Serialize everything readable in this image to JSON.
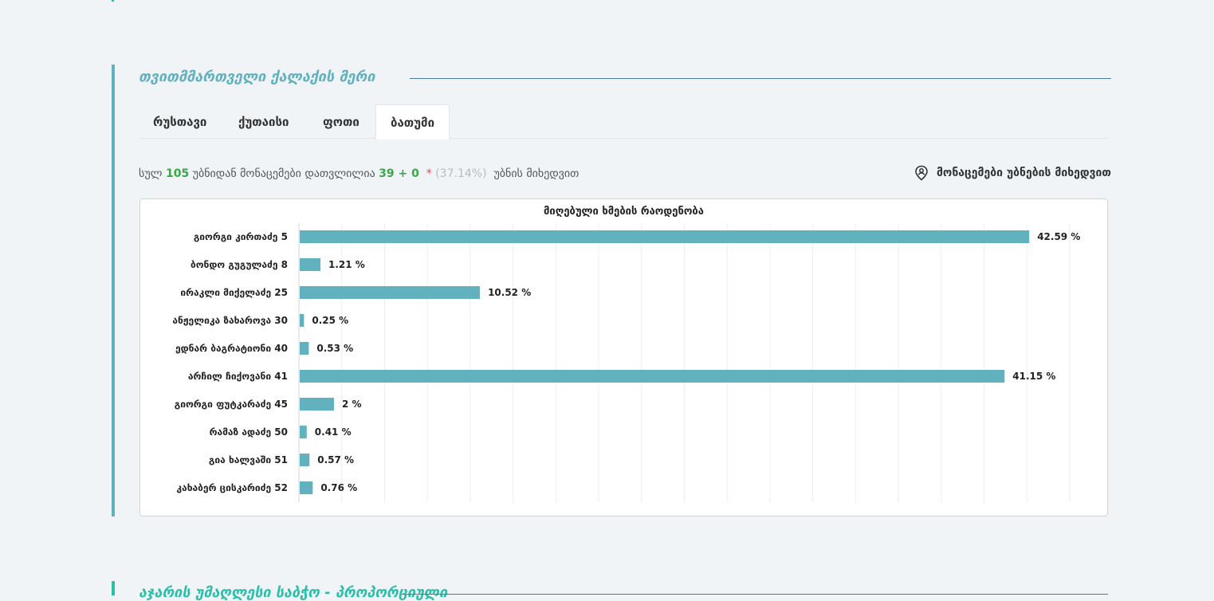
{
  "section": {
    "title": "თვითმმართველი ქალაქის მერი"
  },
  "tabs": [
    {
      "label": "რუსთავი",
      "active": false
    },
    {
      "label": "ქუთაისი",
      "active": false
    },
    {
      "label": "ფოთი",
      "active": false
    },
    {
      "label": "ბათუმი",
      "active": true
    }
  ],
  "summary": {
    "prefix": "სულ",
    "total": "105",
    "middle": "უბნიდან მონაცემები დათვლილია",
    "counted": "39 + 0",
    "star": "*",
    "percent": "(37.14%)",
    "suffix": "უბნის მიხედვით"
  },
  "by_precinct": {
    "label": "მონაცემები უბნების მიხედვით",
    "icon": "location-user-icon"
  },
  "colors": {
    "accent": "#62b1bf",
    "bar": "#62b1bf",
    "green": "#3aa64a",
    "red": "#e04a4a",
    "next_accent": "#2bbfaa"
  },
  "chart_data": {
    "type": "bar",
    "orientation": "horizontal",
    "title": "მიღებული ხმების რაოდენობა",
    "categories": [
      "გიორგი კირთაძე 5",
      "ბონდო გუგულაძე 8",
      "ირაკლი მიქელაძე 25",
      "ანჟელიკა ზახაროვა 30",
      "ედნარ ბაგრატიონი 40",
      "არჩილ ჩიქოვანი 41",
      "გიორგი ფუტკარაძე 45",
      "რამაზ ადაძე 50",
      "გია ხალვაში 51",
      "კახაბერ ცისკარიძე 52"
    ],
    "values": [
      42.59,
      1.21,
      10.52,
      0.25,
      0.53,
      41.15,
      2,
      0.41,
      0.57,
      0.76
    ],
    "value_labels": [
      "42.59 %",
      "1.21 %",
      "10.52 %",
      "0.25 %",
      "0.53 %",
      "41.15 %",
      "2 %",
      "0.41 %",
      "0.57 %",
      "0.76 %"
    ],
    "xlim": [
      0,
      45
    ],
    "grid": true
  },
  "next_section": {
    "title": "აჯარის უმაღლესი საბჭო - პროპორციული"
  }
}
